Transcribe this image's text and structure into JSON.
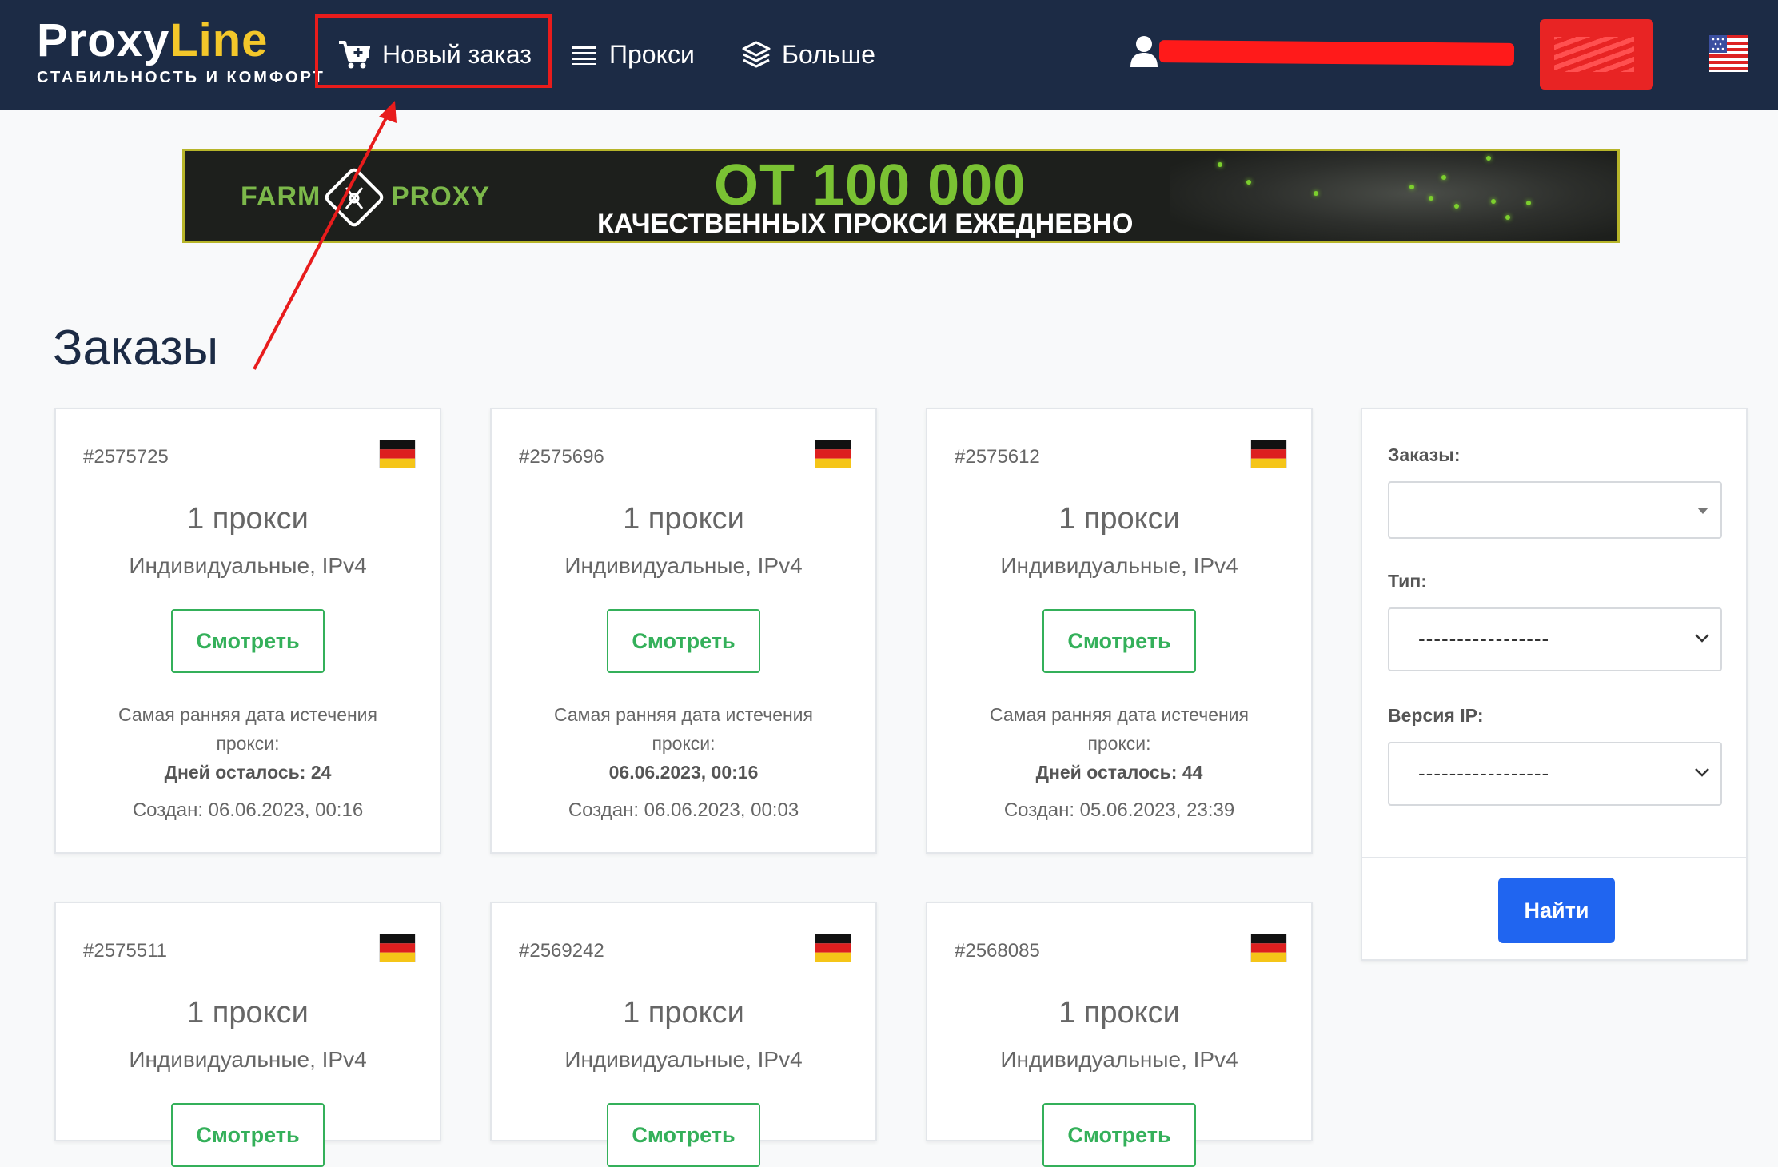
{
  "header": {
    "logo_part1": "Proxy",
    "logo_part2": "Line",
    "logo_tagline": "СТАБИЛЬНОСТЬ И КОМФОРТ",
    "nav": {
      "new_order": "Новый заказ",
      "proxies": "Прокси",
      "more": "Больше"
    }
  },
  "banner": {
    "brand_left": "FARM",
    "brand_right": "PROXY",
    "headline": "ОТ 100 000",
    "subline": "КАЧЕСТВЕННЫХ ПРОКСИ ЕЖЕДНЕВНО"
  },
  "page_title": "Заказы",
  "orders": [
    {
      "id": "#2575725",
      "count": "1 прокси",
      "type": "Индивидуальные, IPv4",
      "button": "Смотреть",
      "exp_label": "Самая ранняя дата истечения прокси:",
      "exp_value": "Дней осталось: 24",
      "created": "Создан: 06.06.2023, 00:16"
    },
    {
      "id": "#2575696",
      "count": "1 прокси",
      "type": "Индивидуальные, IPv4",
      "button": "Смотреть",
      "exp_label": "Самая ранняя дата истечения прокси:",
      "exp_value": "06.06.2023, 00:16",
      "created": "Создан: 06.06.2023, 00:03"
    },
    {
      "id": "#2575612",
      "count": "1 прокси",
      "type": "Индивидуальные, IPv4",
      "button": "Смотреть",
      "exp_label": "Самая ранняя дата истечения прокси:",
      "exp_value": "Дней осталось: 44",
      "created": "Создан: 05.06.2023, 23:39"
    },
    {
      "id": "#2575511",
      "count": "1 прокси",
      "type": "Индивидуальные, IPv4",
      "button": "Смотреть"
    },
    {
      "id": "#2569242",
      "count": "1 прокси",
      "type": "Индивидуальные, IPv4",
      "button": "Смотреть"
    },
    {
      "id": "#2568085",
      "count": "1 прокси",
      "type": "Индивидуальные, IPv4",
      "button": "Смотреть"
    }
  ],
  "filter": {
    "orders_label": "Заказы:",
    "orders_value": "",
    "type_label": "Тип:",
    "type_value": "-----------------",
    "ip_label": "Версия IP:",
    "ip_value": "-----------------",
    "search_button": "Найти"
  },
  "icons": {
    "cart": "cart-icon",
    "list": "list-icon",
    "layers": "layers-icon",
    "user": "user-icon",
    "flag_order": "germany-flag-icon",
    "flag_lang": "us-flag-icon"
  },
  "colors": {
    "header_bg": "#1c2b45",
    "logo_accent": "#f3c72a",
    "view_button": "#34b05a",
    "search_button": "#2065f0",
    "annotation_red": "#e81c1c"
  }
}
